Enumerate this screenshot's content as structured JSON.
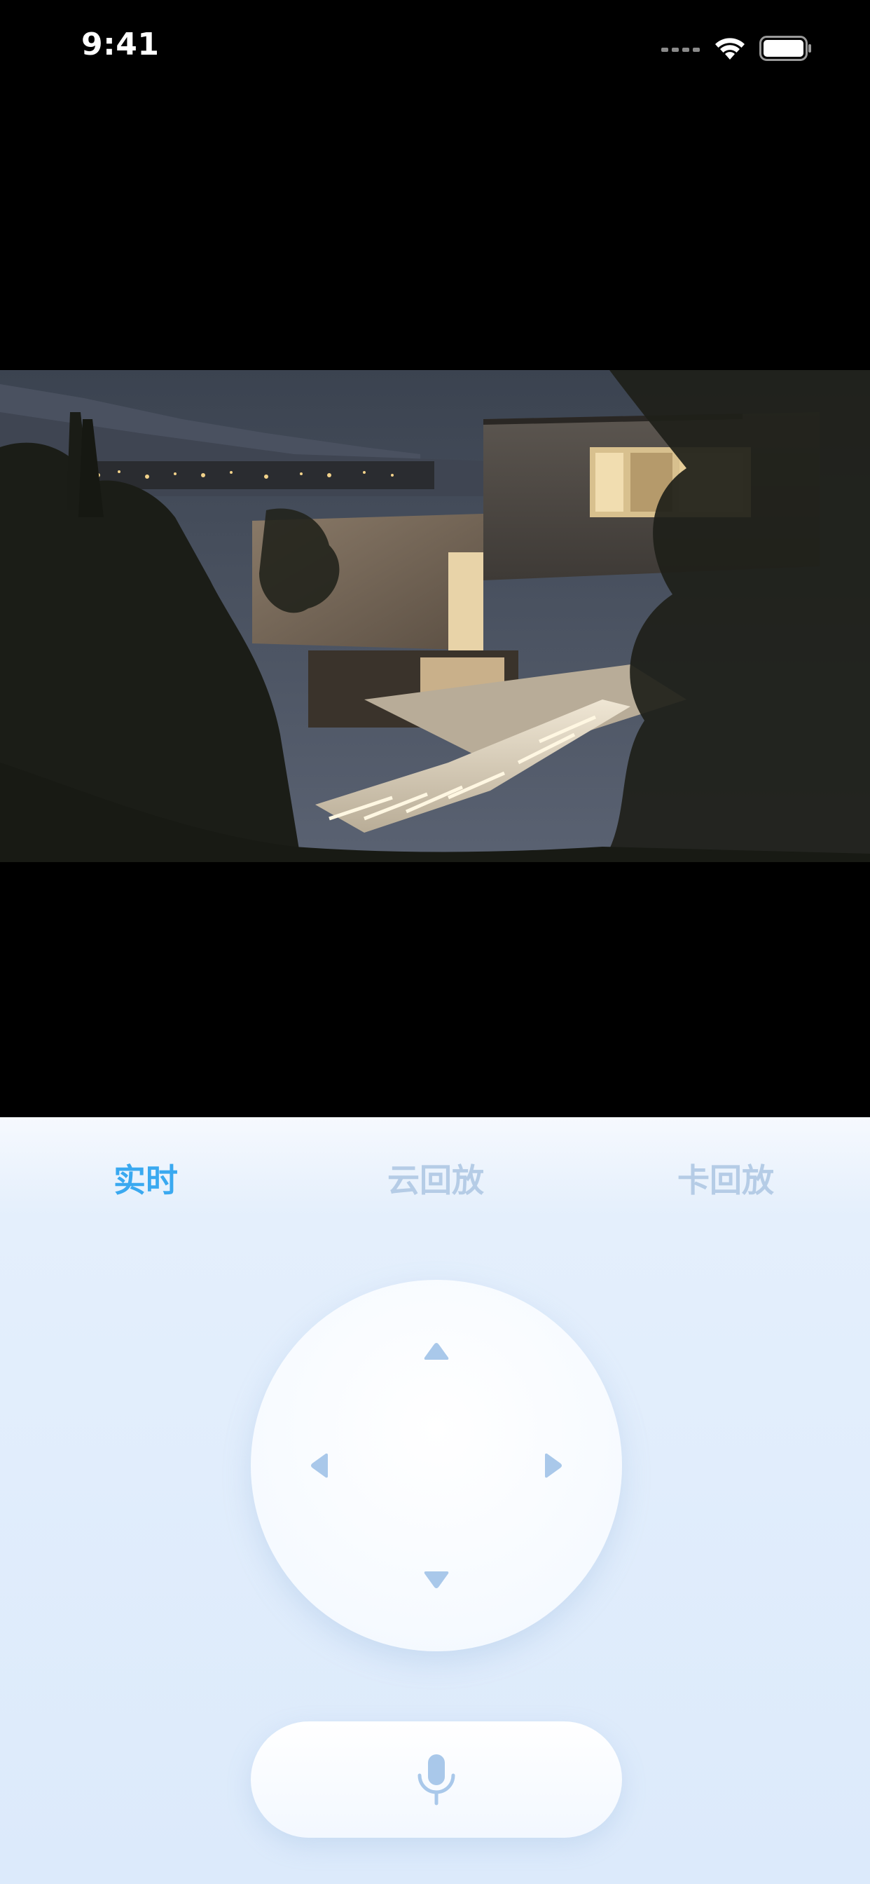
{
  "status_bar": {
    "time": "9:41",
    "icons": [
      "cellular-signal-icon",
      "wifi-icon",
      "battery-icon"
    ]
  },
  "video": {
    "feed": "camera-live-image"
  },
  "tabs": [
    {
      "label": "实时",
      "active": true
    },
    {
      "label": "云回放",
      "active": false
    },
    {
      "label": "卡回放",
      "active": false
    }
  ],
  "controls": {
    "ptz_icons": [
      "arrow-up-icon",
      "arrow-down-icon",
      "arrow-left-icon",
      "arrow-right-icon"
    ],
    "mic_icon": "microphone-icon"
  },
  "colors": {
    "active_tab": "#3aa9f0",
    "inactive_tab": "#b5cce6",
    "icon": "#a9c8ea",
    "panel_bg": "#dceafb"
  }
}
